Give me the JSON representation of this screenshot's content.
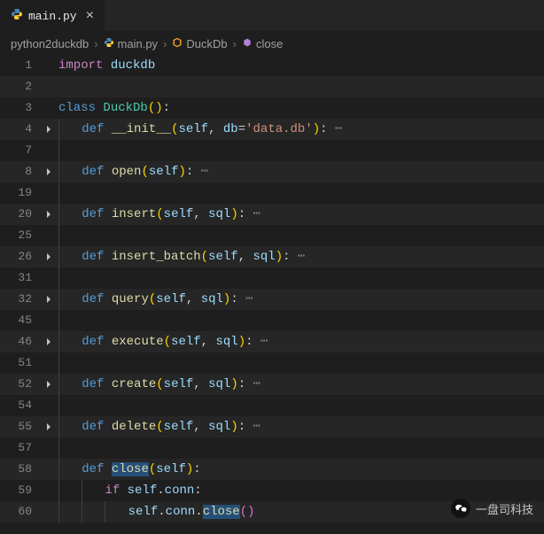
{
  "tab": {
    "filename": "main.py",
    "icon": "python-icon"
  },
  "breadcrumb": {
    "folder": "python2duckdb",
    "file": "main.py",
    "class": "DuckDb",
    "method": "close"
  },
  "code": {
    "lines": [
      {
        "n": 1,
        "fold": "",
        "indent": 0,
        "tokens": [
          [
            "kw",
            "import"
          ],
          [
            "op",
            " "
          ],
          [
            "var",
            "duckdb"
          ]
        ]
      },
      {
        "n": 2,
        "fold": "",
        "indent": 0,
        "tokens": []
      },
      {
        "n": 3,
        "fold": "",
        "indent": 0,
        "tokens": [
          [
            "kw2",
            "class"
          ],
          [
            "op",
            " "
          ],
          [
            "cls",
            "DuckDb"
          ],
          [
            "paren",
            "()"
          ],
          [
            "op",
            ":"
          ]
        ]
      },
      {
        "n": 4,
        "fold": ">",
        "indent": 1,
        "tokens": [
          [
            "kw2",
            "def"
          ],
          [
            "op",
            " "
          ],
          [
            "fn",
            "__init__"
          ],
          [
            "paren",
            "("
          ],
          [
            "var",
            "self"
          ],
          [
            "op",
            ", "
          ],
          [
            "var",
            "db"
          ],
          [
            "op",
            "="
          ],
          [
            "str",
            "'data.db'"
          ],
          [
            "paren",
            ")"
          ],
          [
            "op",
            ":"
          ],
          [
            "dots",
            " ⋯"
          ]
        ]
      },
      {
        "n": 7,
        "fold": "",
        "indent": 1,
        "tokens": []
      },
      {
        "n": 8,
        "fold": ">",
        "indent": 1,
        "tokens": [
          [
            "kw2",
            "def"
          ],
          [
            "op",
            " "
          ],
          [
            "fn",
            "open"
          ],
          [
            "paren",
            "("
          ],
          [
            "var",
            "self"
          ],
          [
            "paren",
            ")"
          ],
          [
            "op",
            ":"
          ],
          [
            "dots",
            " ⋯"
          ]
        ]
      },
      {
        "n": 19,
        "fold": "",
        "indent": 1,
        "tokens": []
      },
      {
        "n": 20,
        "fold": ">",
        "indent": 1,
        "tokens": [
          [
            "kw2",
            "def"
          ],
          [
            "op",
            " "
          ],
          [
            "fn",
            "insert"
          ],
          [
            "paren",
            "("
          ],
          [
            "var",
            "self"
          ],
          [
            "op",
            ", "
          ],
          [
            "var",
            "sql"
          ],
          [
            "paren",
            ")"
          ],
          [
            "op",
            ":"
          ],
          [
            "dots",
            " ⋯"
          ]
        ]
      },
      {
        "n": 25,
        "fold": "",
        "indent": 1,
        "tokens": []
      },
      {
        "n": 26,
        "fold": ">",
        "indent": 1,
        "tokens": [
          [
            "kw2",
            "def"
          ],
          [
            "op",
            " "
          ],
          [
            "fn",
            "insert_batch"
          ],
          [
            "paren",
            "("
          ],
          [
            "var",
            "self"
          ],
          [
            "op",
            ", "
          ],
          [
            "var",
            "sql"
          ],
          [
            "paren",
            ")"
          ],
          [
            "op",
            ":"
          ],
          [
            "dots",
            " ⋯"
          ]
        ]
      },
      {
        "n": 31,
        "fold": "",
        "indent": 1,
        "tokens": []
      },
      {
        "n": 32,
        "fold": ">",
        "indent": 1,
        "tokens": [
          [
            "kw2",
            "def"
          ],
          [
            "op",
            " "
          ],
          [
            "fn",
            "query"
          ],
          [
            "paren",
            "("
          ],
          [
            "var",
            "self"
          ],
          [
            "op",
            ", "
          ],
          [
            "var",
            "sql"
          ],
          [
            "paren",
            ")"
          ],
          [
            "op",
            ":"
          ],
          [
            "dots",
            " ⋯"
          ]
        ]
      },
      {
        "n": 45,
        "fold": "",
        "indent": 1,
        "tokens": []
      },
      {
        "n": 46,
        "fold": ">",
        "indent": 1,
        "tokens": [
          [
            "kw2",
            "def"
          ],
          [
            "op",
            " "
          ],
          [
            "fn",
            "execute"
          ],
          [
            "paren",
            "("
          ],
          [
            "var",
            "self"
          ],
          [
            "op",
            ", "
          ],
          [
            "var",
            "sql"
          ],
          [
            "paren",
            ")"
          ],
          [
            "op",
            ":"
          ],
          [
            "dots",
            " ⋯"
          ]
        ]
      },
      {
        "n": 51,
        "fold": "",
        "indent": 1,
        "tokens": []
      },
      {
        "n": 52,
        "fold": ">",
        "indent": 1,
        "tokens": [
          [
            "kw2",
            "def"
          ],
          [
            "op",
            " "
          ],
          [
            "fn",
            "create"
          ],
          [
            "paren",
            "("
          ],
          [
            "var",
            "self"
          ],
          [
            "op",
            ", "
          ],
          [
            "var",
            "sql"
          ],
          [
            "paren",
            ")"
          ],
          [
            "op",
            ":"
          ],
          [
            "dots",
            " ⋯"
          ]
        ]
      },
      {
        "n": 54,
        "fold": "",
        "indent": 1,
        "tokens": []
      },
      {
        "n": 55,
        "fold": ">",
        "indent": 1,
        "tokens": [
          [
            "kw2",
            "def"
          ],
          [
            "op",
            " "
          ],
          [
            "fn",
            "delete"
          ],
          [
            "paren",
            "("
          ],
          [
            "var",
            "self"
          ],
          [
            "op",
            ", "
          ],
          [
            "var",
            "sql"
          ],
          [
            "paren",
            ")"
          ],
          [
            "op",
            ":"
          ],
          [
            "dots",
            " ⋯"
          ]
        ]
      },
      {
        "n": 57,
        "fold": "",
        "indent": 1,
        "tokens": []
      },
      {
        "n": 58,
        "fold": "",
        "indent": 1,
        "tokens": [
          [
            "kw2",
            "def"
          ],
          [
            "op",
            " "
          ],
          [
            "fn",
            "close"
          ],
          [
            "paren",
            "("
          ],
          [
            "var",
            "self"
          ],
          [
            "paren",
            ")"
          ],
          [
            "op",
            ":"
          ]
        ],
        "sel": "close"
      },
      {
        "n": 59,
        "fold": "",
        "indent": 2,
        "tokens": [
          [
            "kw",
            "if"
          ],
          [
            "op",
            " "
          ],
          [
            "var",
            "self"
          ],
          [
            "op",
            "."
          ],
          [
            "var",
            "conn"
          ],
          [
            "op",
            ":"
          ]
        ]
      },
      {
        "n": 60,
        "fold": "",
        "indent": 3,
        "tokens": [
          [
            "var",
            "self"
          ],
          [
            "op",
            "."
          ],
          [
            "var",
            "conn"
          ],
          [
            "op",
            "."
          ],
          [
            "fn",
            "close"
          ],
          [
            "paren2",
            "()"
          ]
        ],
        "sel": "close"
      }
    ]
  },
  "watermark": {
    "text": "一盘司科技"
  }
}
